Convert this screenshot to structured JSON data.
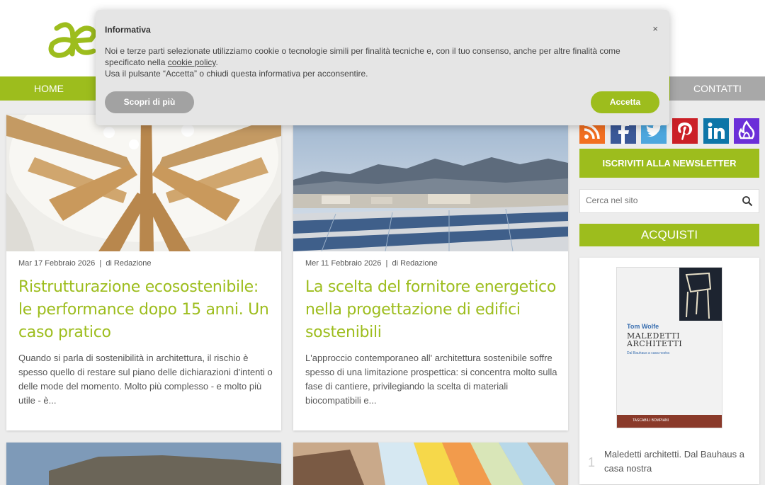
{
  "nav": {
    "home": "HOME",
    "contacts": "CONTATTI"
  },
  "articles": [
    {
      "meta": "Mar 17 Febbraio 2026  |  di Redazione",
      "title": "Ristrutturazione ecosostenibile: le performance dopo 15 anni. Un caso pratico",
      "excerpt": "Quando si parla di sostenibilità in architettura, il rischio è spesso quello di restare sul piano delle dichiarazioni d'intenti o delle mode del momento. Molto più complesso - e molto più utile - è..."
    },
    {
      "meta": "Mer 11 Febbraio 2026  |  di Redazione",
      "title": "La scelta del fornitore energetico nella progettazione di edifici sostenibili",
      "excerpt": "L'approccio contemporaneo all' architettura sostenibile soffre spesso di una limitazione prospettica: si concentra molto sulla fase di cantiere, privilegiando la scelta di materiali biocompatibili e..."
    }
  ],
  "sidebar": {
    "newsletter": "ISCRIVITI ALLA NEWSLETTER",
    "search_placeholder": "Cerca nel sito",
    "acquisti": "ACQUISTI",
    "book": {
      "author": "Tom Wolfe",
      "title_line1": "MALEDETTI",
      "title_line2": "ARCHITETTI",
      "subtitle": "Dal Bauhaus a casa nostra",
      "publisher": "TASCABILI BOMPIANI",
      "rank": "1",
      "name": "Maledetti architetti. Dal Bauhaus a casa nostra"
    }
  },
  "cookie": {
    "title": "Informativa",
    "close": "×",
    "text_before": "Noi e terze parti selezionate utilizziamo cookie o tecnologie simili per finalità tecniche e, con il tuo consenso, anche per altre finalità come specificato nella ",
    "link": "cookie policy",
    "text_after": ".",
    "line2": "Usa il pulsante “Accetta” o chiudi questa informativa per acconsentire.",
    "more": "Scopri di più",
    "accept": "Accetta"
  },
  "colors": {
    "brand_green": "#9dbd1d",
    "nav_grey": "#a8a8a8"
  }
}
